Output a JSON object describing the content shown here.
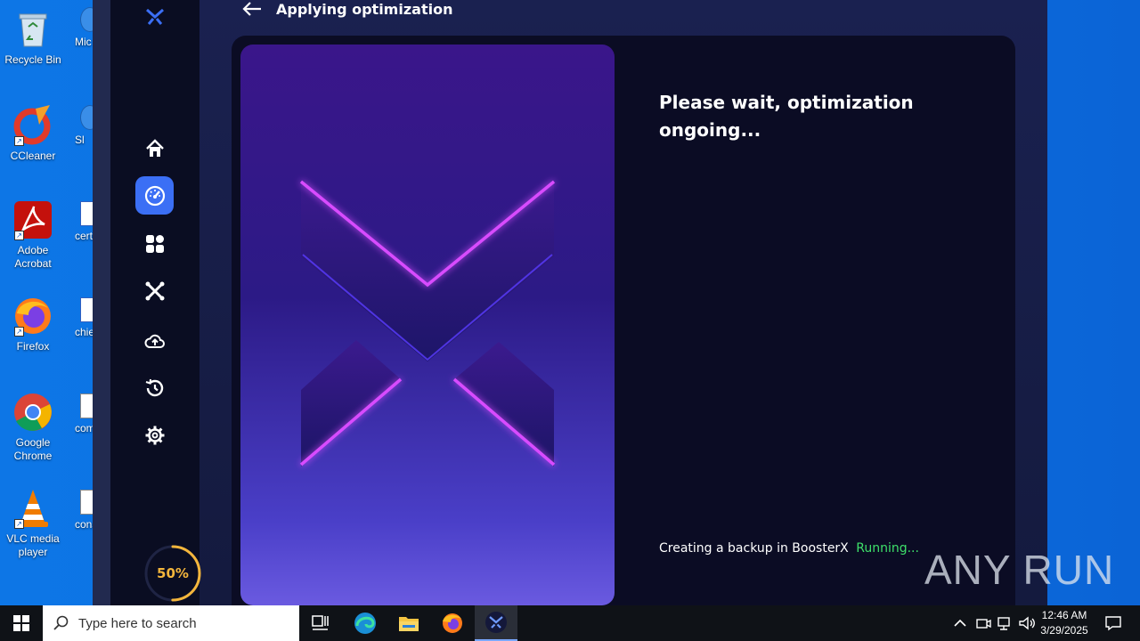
{
  "desktop": {
    "icons": [
      {
        "label": "Recycle Bin"
      },
      {
        "label": "CCleaner"
      },
      {
        "label": "Adobe Acrobat"
      },
      {
        "label": "Firefox"
      },
      {
        "label": "Google Chrome"
      },
      {
        "label": "VLC media player"
      }
    ],
    "partial_icons": [
      {
        "label": "Mic E"
      },
      {
        "label": "Sl"
      },
      {
        "label": "certi"
      },
      {
        "label": "chief"
      },
      {
        "label": "com"
      },
      {
        "label": "cons"
      }
    ]
  },
  "app": {
    "header": {
      "title": "Applying optimization"
    },
    "sidebar": {
      "items": [
        {
          "icon": "home-icon",
          "active": false
        },
        {
          "icon": "speedometer-icon",
          "active": true
        },
        {
          "icon": "apps-grid-icon",
          "active": false
        },
        {
          "icon": "tools-icon",
          "active": false
        },
        {
          "icon": "cloud-upload-icon",
          "active": false
        },
        {
          "icon": "history-icon",
          "active": false
        },
        {
          "icon": "settings-gear-icon",
          "active": false
        }
      ],
      "progress": {
        "label": "50%",
        "value": 0.5
      }
    },
    "main": {
      "message": "Please wait, optimization ongoing...",
      "status_prefix": "Creating a backup in BoosterX",
      "status_state": "Running..."
    },
    "colors": {
      "accent": "#3b6ff5",
      "running": "#3ee06a",
      "progress": "#f4b63c"
    }
  },
  "watermark": {
    "text": "ANY RUN"
  },
  "taskbar": {
    "search_placeholder": "Type here to search",
    "clock": {
      "time": "12:46 AM",
      "date": "3/29/2025"
    }
  }
}
